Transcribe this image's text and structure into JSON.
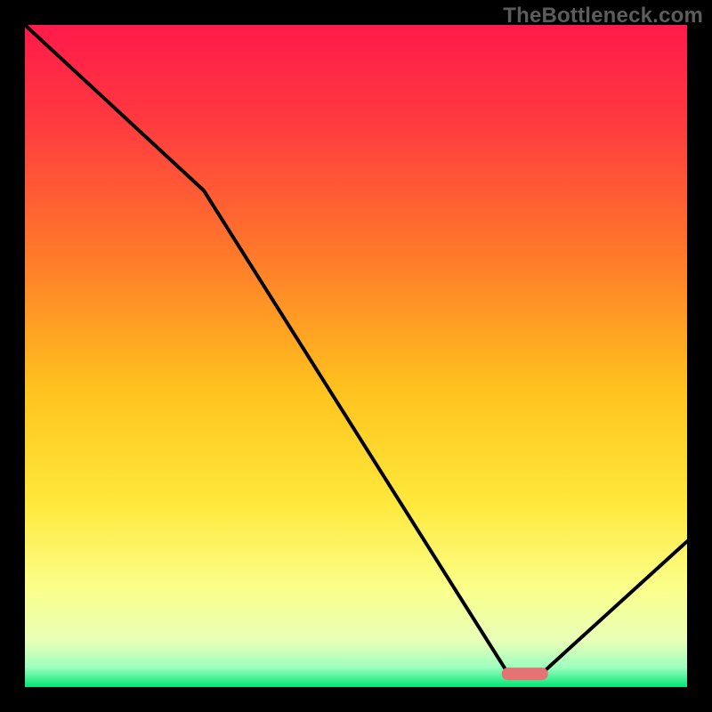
{
  "watermark": "TheBottleneck.com",
  "chart_data": {
    "type": "line",
    "title": "",
    "xlabel": "",
    "ylabel": "",
    "xlim": [
      0,
      100
    ],
    "ylim": [
      0,
      100
    ],
    "x": [
      0,
      27,
      73,
      78,
      100
    ],
    "values": [
      100,
      75,
      2,
      2,
      22
    ],
    "marker": {
      "x_range": [
        72,
        79
      ],
      "y": 2,
      "color": "#e57373"
    },
    "gradient_stops": [
      {
        "offset": 0.0,
        "color": "#ff1a4b"
      },
      {
        "offset": 0.15,
        "color": "#ff3b3f"
      },
      {
        "offset": 0.35,
        "color": "#ff7a2a"
      },
      {
        "offset": 0.55,
        "color": "#ffc21e"
      },
      {
        "offset": 0.72,
        "color": "#ffe83a"
      },
      {
        "offset": 0.85,
        "color": "#fbff8a"
      },
      {
        "offset": 0.93,
        "color": "#e8ffb8"
      },
      {
        "offset": 0.97,
        "color": "#9effbe"
      },
      {
        "offset": 1.0,
        "color": "#00e676"
      }
    ],
    "border_color": "#000000"
  }
}
